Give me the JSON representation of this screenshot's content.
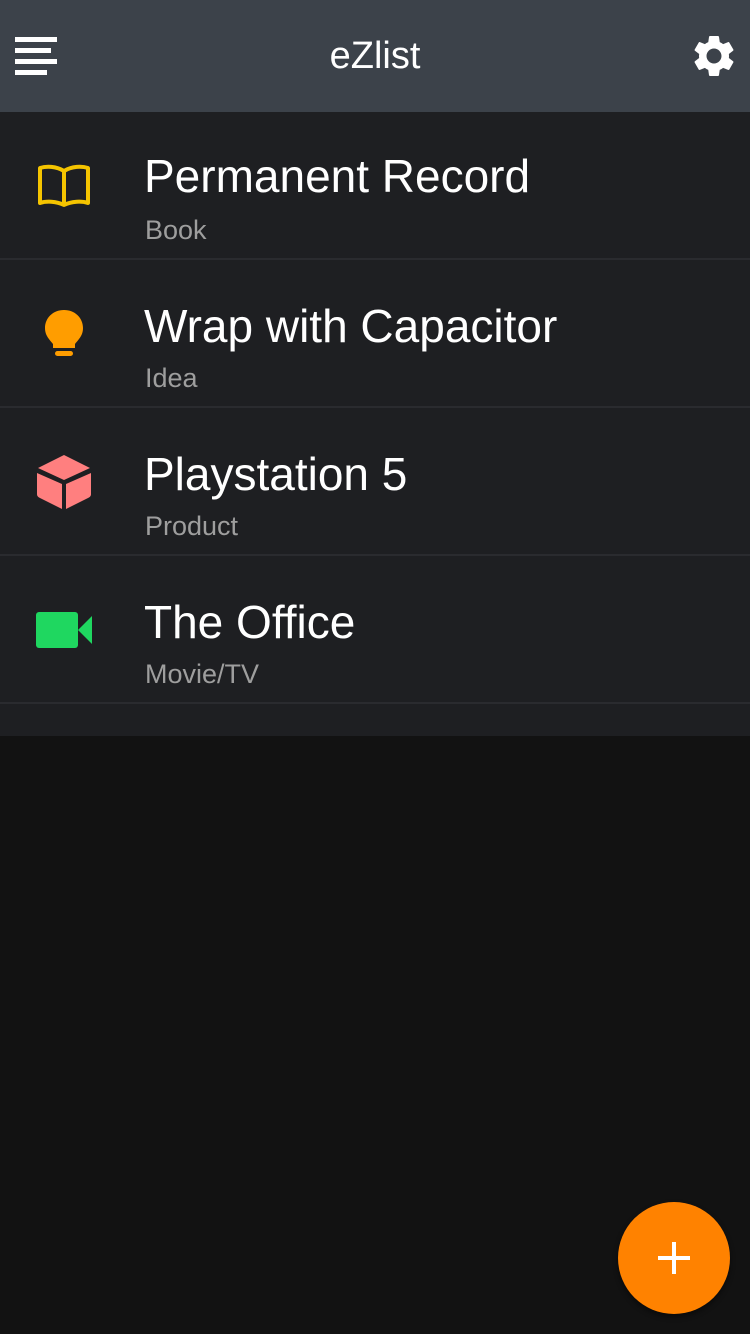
{
  "header": {
    "title": "eZlist",
    "menu_icon": "menu-icon",
    "settings_icon": "gear-icon"
  },
  "items": [
    {
      "title": "Permanent Record",
      "category": "Book",
      "icon": "book-icon",
      "icon_color": "#f5c400"
    },
    {
      "title": "Wrap with Capacitor",
      "category": "Idea",
      "icon": "bulb-icon",
      "icon_color": "#ff9d00"
    },
    {
      "title": "Playstation 5",
      "category": "Product",
      "icon": "cube-icon",
      "icon_color": "#ff7f7f"
    },
    {
      "title": "The Office",
      "category": "Movie/TV",
      "icon": "videocam-icon",
      "icon_color": "#1fd760"
    }
  ],
  "fab": {
    "icon": "plus-icon",
    "color": "#ff8200"
  }
}
